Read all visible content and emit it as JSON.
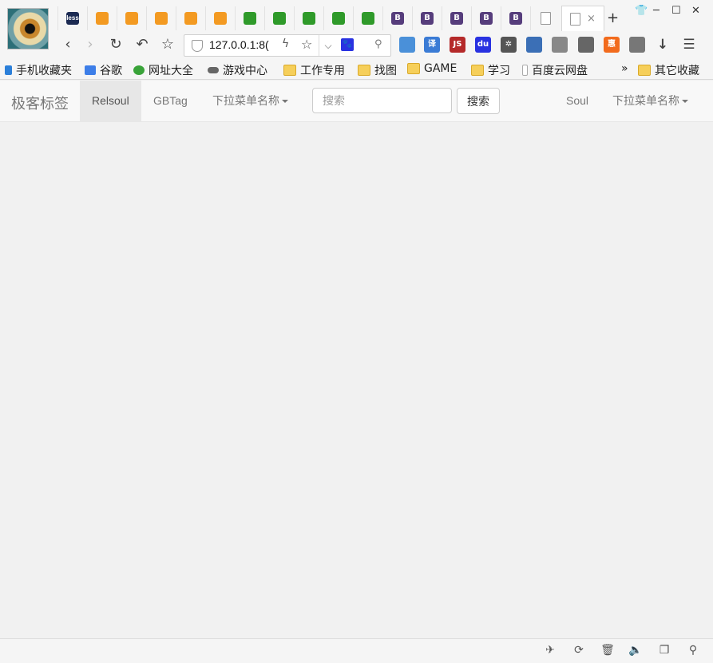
{
  "tabs": [
    {
      "favicon": "less-icon",
      "text": "less",
      "style": "fav-less"
    },
    {
      "favicon": "orange-face-icon",
      "text": "",
      "style": "fav-orange"
    },
    {
      "favicon": "orange-face-icon",
      "text": "",
      "style": "fav-orange"
    },
    {
      "favicon": "orange-face-icon",
      "text": "",
      "style": "fav-orange"
    },
    {
      "favicon": "orange-face-icon",
      "text": "",
      "style": "fav-orange"
    },
    {
      "favicon": "orange-face-icon",
      "text": "",
      "style": "fav-orange"
    },
    {
      "favicon": "green-book-icon",
      "text": "",
      "style": "fav-green"
    },
    {
      "favicon": "green-book-icon",
      "text": "",
      "style": "fav-green"
    },
    {
      "favicon": "green-book-icon",
      "text": "",
      "style": "fav-green"
    },
    {
      "favicon": "green-book-icon",
      "text": "",
      "style": "fav-green"
    },
    {
      "favicon": "green-book-icon",
      "text": "",
      "style": "fav-green"
    },
    {
      "favicon": "bootstrap-icon",
      "text": "B",
      "style": "fav-b"
    },
    {
      "favicon": "bootstrap-icon",
      "text": "B",
      "style": "fav-b"
    },
    {
      "favicon": "bootstrap-icon",
      "text": "B",
      "style": "fav-b"
    },
    {
      "favicon": "bootstrap-icon",
      "text": "B",
      "style": "fav-b"
    },
    {
      "favicon": "bootstrap-icon",
      "text": "B",
      "style": "fav-b"
    },
    {
      "favicon": "document-icon",
      "text": "",
      "style": "fav-doc"
    }
  ],
  "active_tab": {
    "favicon": "document-icon",
    "close": "×"
  },
  "new_tab_label": "+",
  "address_bar": {
    "url": "127.0.0.1:8("
  },
  "extensions": [
    {
      "name": "windows-tiles-icon",
      "text": "",
      "color": "#4a90d9"
    },
    {
      "name": "translate-icon",
      "text": "译",
      "color": "#3a7bd5"
    },
    {
      "name": "js-icon",
      "text": "JS",
      "color": "#b52a2a"
    },
    {
      "name": "baidu-paw-icon",
      "text": "du",
      "color": "#2932e1"
    },
    {
      "name": "gear-flower-icon",
      "text": "✲",
      "color": "#555555"
    },
    {
      "name": "screenshot-icon",
      "text": "",
      "color": "#3b6fb6"
    },
    {
      "name": "globe-icon",
      "text": "",
      "color": "#888888"
    },
    {
      "name": "key-badge-icon",
      "text": "",
      "color": "#666666"
    },
    {
      "name": "taobao-icon",
      "text": "惠",
      "color": "#f26b1d"
    },
    {
      "name": "cloud-icon",
      "text": "",
      "color": "#777777"
    },
    {
      "name": "download-icon",
      "text": "↓",
      "color": "#444444"
    },
    {
      "name": "menu-icon",
      "text": "☰",
      "color": "#444444"
    }
  ],
  "bookmarks": [
    {
      "label": "手机收藏夹",
      "icon": "phone-icon",
      "ic": "ic-phone"
    },
    {
      "label": "谷歌",
      "icon": "google-icon",
      "ic": "ic-g"
    },
    {
      "label": "网址大全",
      "icon": "web-directory-icon",
      "ic": "ic-web"
    },
    {
      "label": "游戏中心",
      "icon": "gamepad-icon",
      "ic": "ic-game"
    },
    {
      "label": "工作专用",
      "icon": "folder-icon",
      "ic": "ic-folder"
    },
    {
      "label": "找图",
      "icon": "folder-icon",
      "ic": "ic-folder"
    },
    {
      "label": "GAME",
      "icon": "folder-icon",
      "ic": "ic-folder"
    },
    {
      "label": "学习",
      "icon": "folder-icon",
      "ic": "ic-folder"
    },
    {
      "label": "百度云网盘",
      "icon": "document-icon",
      "ic": "ic-doc"
    }
  ],
  "bookmarks_more": "»",
  "bookmarks_other": "其它收藏",
  "app": {
    "brand": "极客标签",
    "nav_left": [
      {
        "label": "Relsoul",
        "active": true
      },
      {
        "label": "GBTag",
        "active": false
      }
    ],
    "dropdown_left": "下拉菜单名称",
    "search_placeholder": "搜索",
    "search_button": "搜索",
    "nav_right_link": "Soul",
    "dropdown_right": "下拉菜单名称"
  }
}
